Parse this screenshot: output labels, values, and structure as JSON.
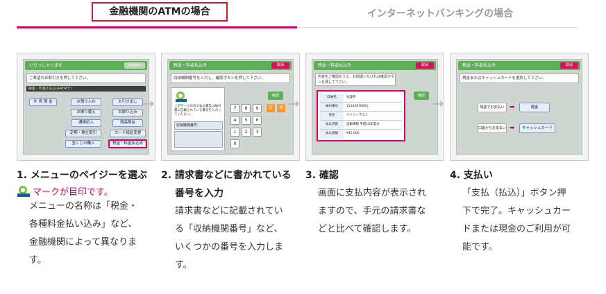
{
  "tabs": {
    "active": "金融機関のATMの場合",
    "inactive": "インターネットバンキングの場合"
  },
  "screen1": {
    "header": "いらっしゃいませ",
    "english": "English",
    "message": "ご希望のお取引きを押して下さい。",
    "bar": "税金・料金の払込みATMで！",
    "buttons": [
      "外 貨 預 金",
      "お預け入れ",
      "お引き出し",
      "お振り替え",
      "お振り込み",
      "通帳記入",
      "残高照会",
      "定期・積立取引",
      "カード暗証変更",
      "宝くじの購入",
      "税金・料金払込み"
    ]
  },
  "screen2": {
    "header": "税金・料金払込み",
    "cancel": "取消",
    "message": "収納機関番号を入力し、確認ボタンを押して下さい。",
    "note": "上記マークのある払込書又は納付書に記載されている番号を入力してください。",
    "field_label": "収納機関番号",
    "keys": [
      "7",
      "8",
      "9",
      "4",
      "5",
      "6",
      "1",
      "2",
      "3",
      "0"
    ],
    "ok": "確認",
    "clear": "訂",
    "back": "消"
  },
  "screen3": {
    "header": "税金・料金払込み",
    "cancel": "取消",
    "message": "内容をご確認のうえ、お間違いなければ確認ボタンを押して下さい。",
    "ok": "確認",
    "rows": [
      {
        "k": "収納先",
        "v": "佐賀県"
      },
      {
        "k": "納付番号",
        "v": "12345678901"
      },
      {
        "k": "氏名",
        "v": "ペイジーテスト"
      },
      {
        "k": "払込内容",
        "v": "自動車税 平成18年度分"
      },
      {
        "k": "払込金額",
        "v": "¥45,000"
      }
    ]
  },
  "screen4": {
    "header": "税金・料金払込み",
    "cancel": "取消",
    "message": "現金またはキャッシュカードを選択して下さい。",
    "row1_label": "現金でお支払い",
    "row1_btn": "現金",
    "row2_label": "口座からお支払い",
    "row2_btn": "キャッシュカード"
  },
  "steps": [
    {
      "title": "1. メニューのペイジーを選ぶ",
      "mark_text": "マークが目印です。",
      "lines": [
        "メニューの名称は「税金・",
        "各種料金払い込み」など、",
        "金融機関によって異なりま",
        "す。"
      ]
    },
    {
      "title": "2. 請求書などに書かれている",
      "title2": "番号を入力",
      "lines": [
        "請求書などに記載されてい",
        "る「収納機関番号」など、",
        "いくつかの番号を入力しま",
        "す。"
      ]
    },
    {
      "title": "3. 確認",
      "lines": [
        "画面に支払内容が表示され",
        "ますので、手元の請求書な",
        "どと比べて確認します。"
      ]
    },
    {
      "title": "4. 支払い",
      "lines": [
        "「支払（払込）」ボタン押",
        "下で完了。キャッシュカー",
        "ドまたは現金のご利用が可",
        "能です。"
      ]
    }
  ],
  "arrow": "→",
  "colors": {
    "accent": "#d5005f",
    "tab_border": "#d9142b",
    "atm_green": "#5fae5a"
  },
  "icons": {
    "pay_easy": "pay-easy-logo-icon"
  }
}
